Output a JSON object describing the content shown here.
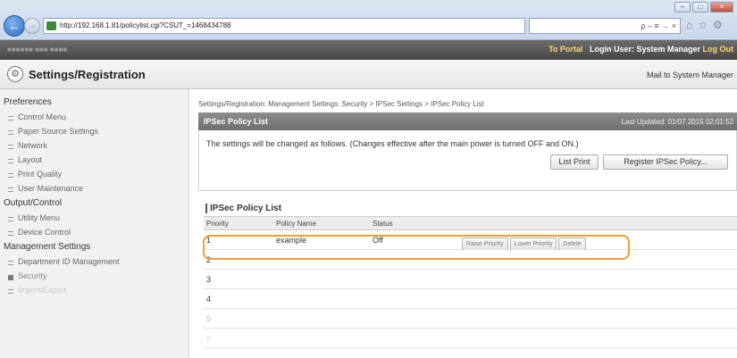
{
  "browser": {
    "address": "http://192.168.1.81/policylist.cgi?CSUT_=1468434788",
    "search_text": "ρ – ≡ → ×",
    "window_controls": [
      "–",
      "□",
      "×"
    ],
    "tool_icons": [
      "⌂",
      "☆",
      "⚙"
    ]
  },
  "portal": {
    "device_name": "■■■■■■ ■■■ ■■■■",
    "to_portal": "To Portal",
    "login_user": "Login User: System Manager",
    "logout": "Log Out"
  },
  "header": {
    "title": "Settings/Registration",
    "mail_link": "Mail to System Manager"
  },
  "sidebar": {
    "sections": [
      {
        "label": "Preferences",
        "items": [
          {
            "label": "Control Menu"
          },
          {
            "label": "Paper Source Settings"
          },
          {
            "label": "Network"
          },
          {
            "label": "Layout"
          },
          {
            "label": "Print Quality"
          },
          {
            "label": "User Maintenance"
          }
        ]
      },
      {
        "label": "Output/Control",
        "items": [
          {
            "label": "Utility Menu"
          },
          {
            "label": "Device Control"
          }
        ]
      },
      {
        "label": "Management Settings",
        "items": [
          {
            "label": "Department ID Management"
          },
          {
            "label": "Security"
          },
          {
            "label": "Import/Export"
          }
        ]
      }
    ]
  },
  "main": {
    "breadcrumb": "Settings/Registration: Management Settings: Security > IPSec Settings > IPSec Policy List",
    "section_title": "IPSec Policy List",
    "last_updated": "Last Updated: 01/07 2015 02:01:52",
    "info_text": "The settings will be changed as follows. (Changes effective after the main power is turned OFF and ON.)",
    "list_print_label": "List Print",
    "register_label": "Register IPSec Policy...",
    "list_title": "IPSec Policy List",
    "columns": [
      "Priority",
      "Policy Name",
      "Status"
    ],
    "row_buttons": [
      "Raise Priority",
      "Lower Priority",
      "Delete"
    ],
    "rows": [
      {
        "priority": "1",
        "name": "example",
        "status": "Off"
      },
      {
        "priority": "2",
        "name": "",
        "status": ""
      },
      {
        "priority": "3",
        "name": "",
        "status": ""
      },
      {
        "priority": "4",
        "name": "",
        "status": ""
      },
      {
        "priority": "5",
        "name": "",
        "status": ""
      },
      {
        "priority": "6",
        "name": "",
        "status": ""
      }
    ]
  },
  "colors": {
    "highlight": "#f0a030",
    "section_bar": "#7a7a7a",
    "portal_link": "#ffd76a"
  }
}
